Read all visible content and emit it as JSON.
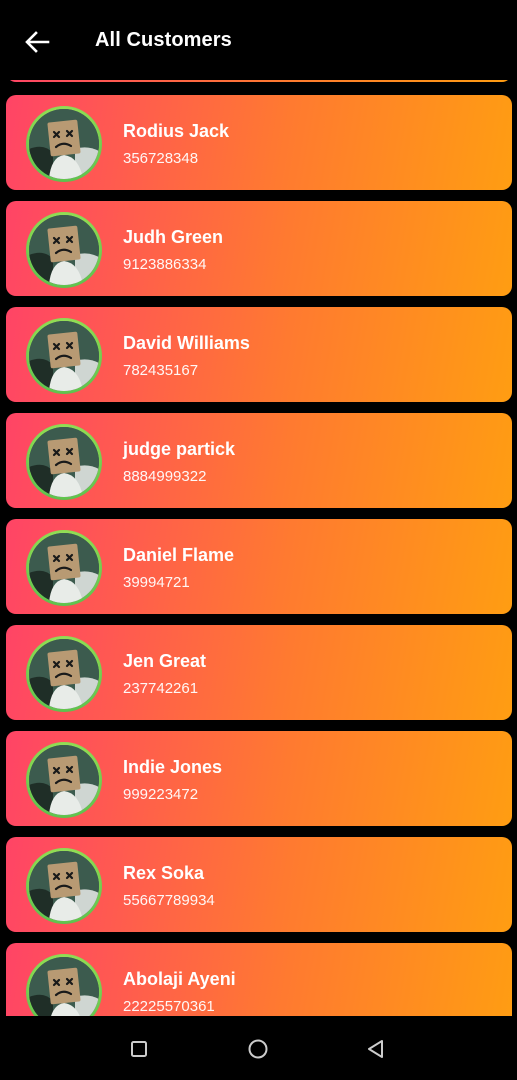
{
  "header": {
    "title": "All Customers",
    "back_icon": "arrow-left-icon"
  },
  "colors": {
    "background": "#000000",
    "card_gradient_start": "#ff4466",
    "card_gradient_end": "#ff9d12",
    "avatar_ring": "#8fdc52"
  },
  "customers": [
    {
      "name": "Rodius Jack",
      "phone": "356728348"
    },
    {
      "name": "Judh Green",
      "phone": "9123886334"
    },
    {
      "name": "David Williams",
      "phone": "782435167"
    },
    {
      "name": "judge partick",
      "phone": "8884999322"
    },
    {
      "name": "Daniel Flame",
      "phone": "39994721"
    },
    {
      "name": "Jen Great",
      "phone": "237742261"
    },
    {
      "name": "Indie Jones",
      "phone": "999223472"
    },
    {
      "name": "Rex Soka",
      "phone": "55667789934"
    },
    {
      "name": "Abolaji Ayeni",
      "phone": "22225570361"
    }
  ],
  "navigation_bar": {
    "recents_icon": "square-icon",
    "home_icon": "circle-icon",
    "back_icon": "triangle-back-icon"
  }
}
